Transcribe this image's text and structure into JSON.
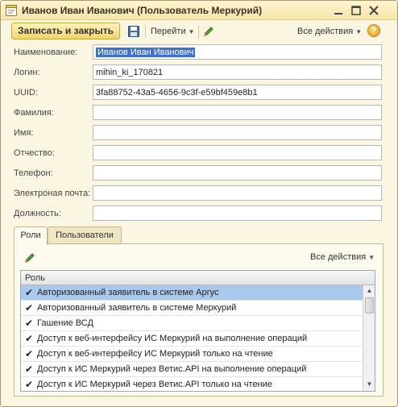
{
  "window": {
    "title": "Иванов Иван Иванович (Пользователь Меркурий)"
  },
  "toolbar": {
    "save_close_label": "Записать и закрыть",
    "goto_label": "Перейти",
    "all_actions_label": "Все действия",
    "help_label": "?"
  },
  "fields": [
    {
      "label": "Наименование:",
      "value": "Иванов Иван Иванович"
    },
    {
      "label": "Логин:",
      "value": "mihin_ki_170821"
    },
    {
      "label": "UUID:",
      "value": "3fa88752-43a5-4656-9c3f-e59bf459e8b1"
    },
    {
      "label": "Фамилия:",
      "value": ""
    },
    {
      "label": "Имя:",
      "value": ""
    },
    {
      "label": "Отчество:",
      "value": ""
    },
    {
      "label": "Телефон:",
      "value": ""
    },
    {
      "label": "Электроная почта:",
      "value": ""
    },
    {
      "label": "Должность:",
      "value": ""
    }
  ],
  "tabs": [
    {
      "label": "Роли",
      "active": true
    },
    {
      "label": "Пользователи",
      "active": false
    }
  ],
  "roles_panel": {
    "all_actions_label": "Все действия",
    "column_header": "Роль",
    "rows": [
      {
        "name": "Авторизованный заявитель в системе Аргус",
        "checked": true,
        "selected": true
      },
      {
        "name": "Авторизованный заявитель в системе Меркурий",
        "checked": true,
        "selected": false
      },
      {
        "name": "Гашение ВСД",
        "checked": true,
        "selected": false
      },
      {
        "name": "Доступ к веб-интерфейсу ИС Меркурий на выполнение операций",
        "checked": true,
        "selected": false
      },
      {
        "name": "Доступ к веб-интерфейсу ИС Меркурий только на чтение",
        "checked": true,
        "selected": false
      },
      {
        "name": "Доступ к ИС Меркурий через Ветис.API на выполнение операций",
        "checked": true,
        "selected": false
      },
      {
        "name": "Доступ к ИС Меркурий через Ветис.API только на чтение",
        "checked": true,
        "selected": false
      }
    ]
  },
  "icons": {
    "window": "form-icon",
    "minimize": "minimize-icon",
    "maximize": "maximize-icon",
    "close": "close-icon",
    "save": "floppy-disk-icon",
    "edit": "pencil-icon",
    "check": "checkmark-icon"
  },
  "colors": {
    "window_bg": "#fbf6e2",
    "primary_button": "#f1d56a",
    "selection": "#3b73c8",
    "selected_row": "#a9c9ec"
  }
}
